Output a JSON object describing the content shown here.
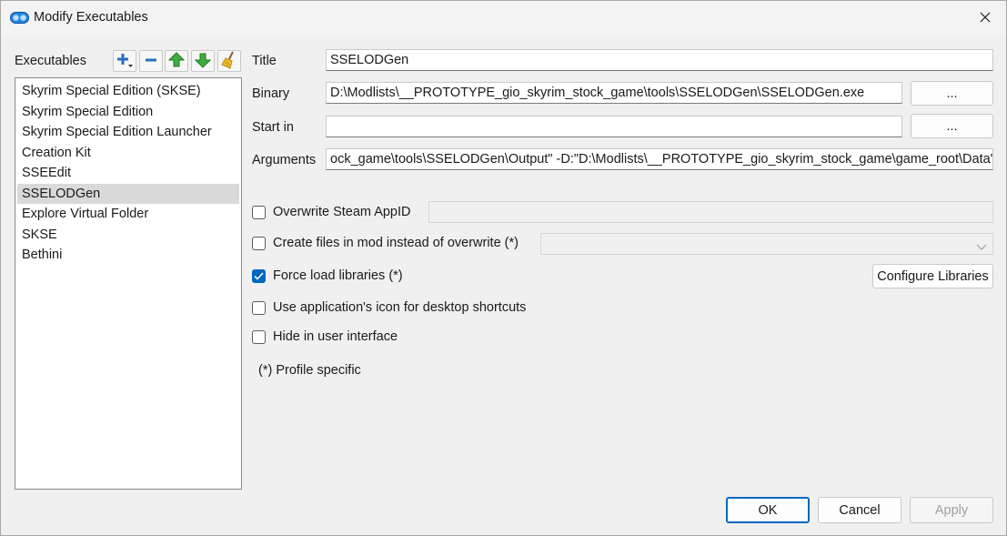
{
  "window": {
    "title": "Modify Executables",
    "app_icon": "mo2-logo-icon",
    "close_icon": "close-icon"
  },
  "left_panel": {
    "label": "Executables",
    "toolbar": {
      "add_icon": "add-dropdown-icon",
      "remove_icon": "remove-icon",
      "move_up_icon": "arrow-up-icon",
      "move_down_icon": "arrow-down-icon",
      "clear_icon": "broom-icon"
    },
    "items": [
      "Skyrim Special Edition (SKSE)",
      "Skyrim Special Edition",
      "Skyrim Special Edition Launcher",
      "Creation Kit",
      "SSEEdit",
      "SSELODGen",
      "Explore Virtual Folder",
      "SKSE",
      "Bethini"
    ],
    "selected_index": 5
  },
  "form": {
    "title_label": "Title",
    "title_value": "SSELODGen",
    "binary_label": "Binary",
    "binary_value": "D:\\Modlists\\__PROTOTYPE_gio_skyrim_stock_game\\tools\\SSELODGen\\SSELODGen.exe",
    "browse_label": "...",
    "start_in_label": "Start in",
    "start_in_value": "",
    "arguments_label": "Arguments",
    "arguments_value": "ock_game\\tools\\SSELODGen\\Output\" -D:\"D:\\Modlists\\__PROTOTYPE_gio_skyrim_stock_game\\game_root\\Data\""
  },
  "options": {
    "overwrite_appid": {
      "label": "Overwrite Steam AppID",
      "checked": false
    },
    "create_files": {
      "label": "Create files in mod instead of overwrite (*)",
      "checked": false
    },
    "force_load": {
      "label": "Force load libraries (*)",
      "checked": true
    },
    "configure_libraries_label": "Configure Libraries",
    "use_icon": {
      "label": "Use application's icon for desktop shortcuts",
      "checked": false
    },
    "hide_ui": {
      "label": "Hide in user interface",
      "checked": false
    },
    "profile_note": "(*) Profile specific"
  },
  "footer": {
    "ok_label": "OK",
    "cancel_label": "Cancel",
    "apply_label": "Apply"
  },
  "colors": {
    "accent": "#0067c0",
    "background": "#f0f0f0",
    "selection": "#d9d9d9"
  }
}
